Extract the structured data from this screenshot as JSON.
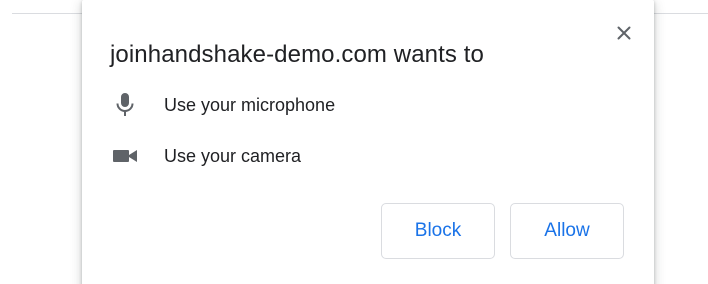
{
  "dialog": {
    "title": "joinhandshake-demo.com wants to",
    "permissions": [
      {
        "icon": "microphone-icon",
        "label": "Use your microphone"
      },
      {
        "icon": "camera-icon",
        "label": "Use your camera"
      }
    ],
    "buttons": {
      "block_label": "Block",
      "allow_label": "Allow"
    },
    "close_icon": "close-icon"
  },
  "colors": {
    "text": "#202124",
    "icon": "#5f6368",
    "accent": "#1a73e8",
    "border": "#dadce0"
  }
}
